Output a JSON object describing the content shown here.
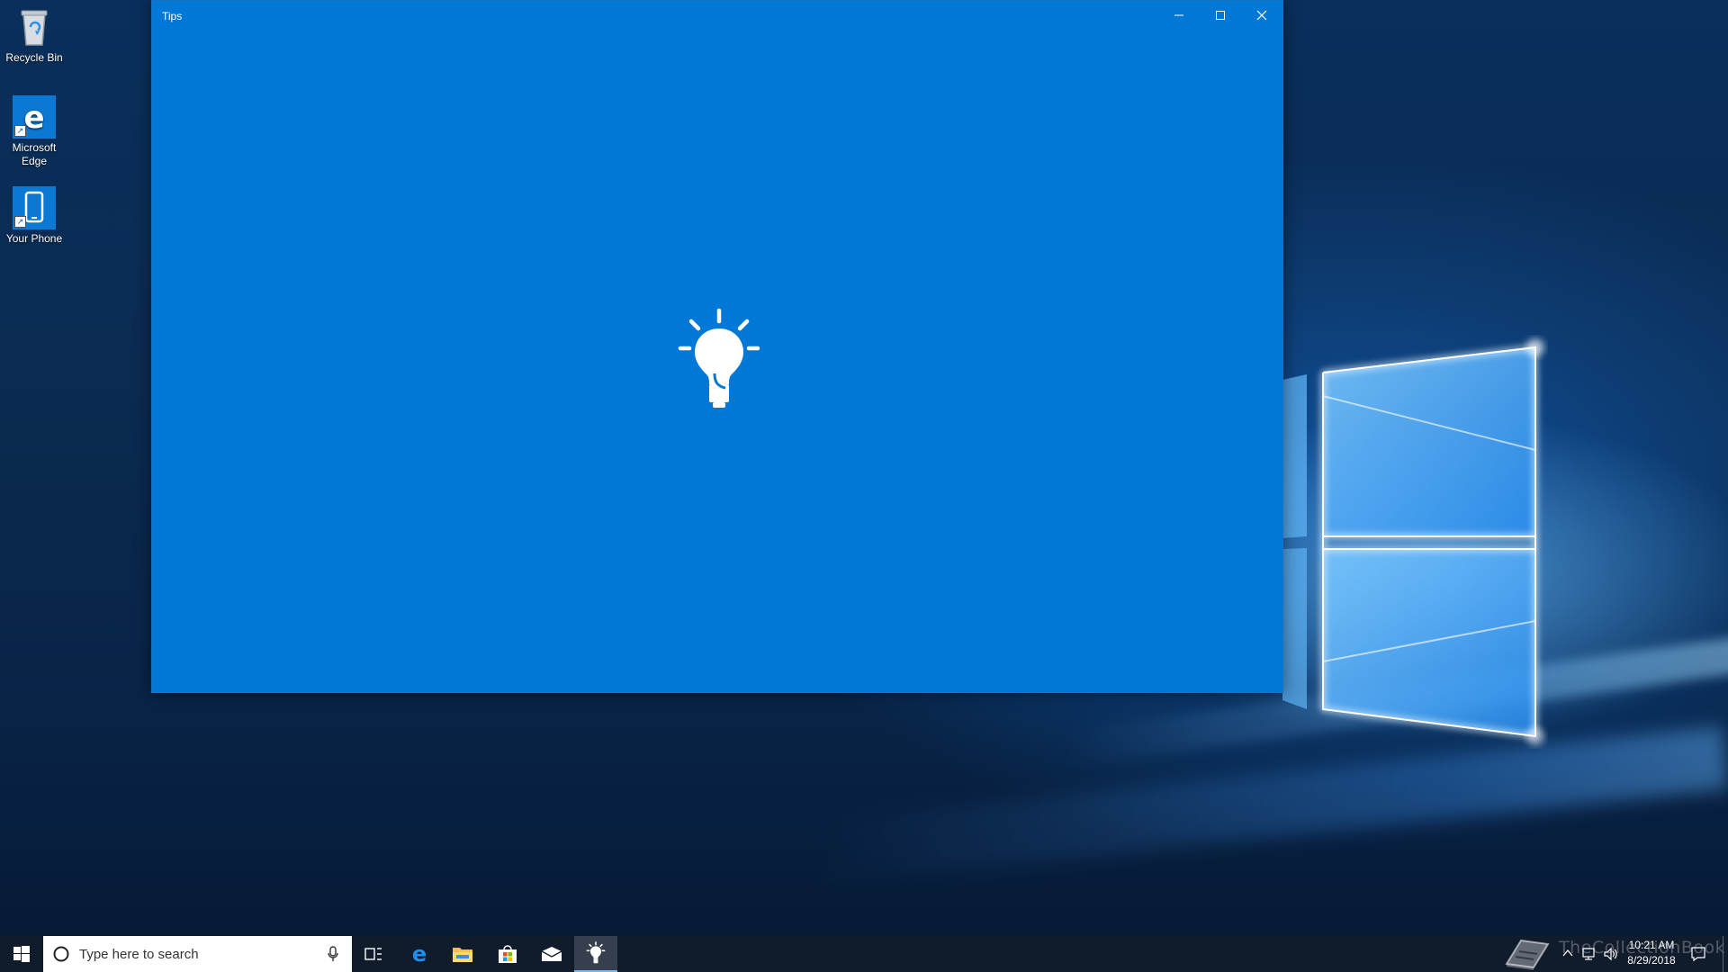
{
  "desktop": {
    "icons": [
      {
        "label": "Recycle Bin",
        "icon": "recycle-bin-icon"
      },
      {
        "label": "Microsoft Edge",
        "icon": "edge-icon"
      },
      {
        "label": "Your Phone",
        "icon": "phone-icon"
      }
    ]
  },
  "window": {
    "title": "Tips",
    "background": "#0078d7",
    "splash_icon": "lightbulb-icon",
    "controls": {
      "minimize": "minimize-icon",
      "maximize": "maximize-icon",
      "close": "close-icon"
    }
  },
  "taskbar": {
    "background": "#101b2b",
    "search_placeholder": "Type here to search",
    "pinned": [
      {
        "name": "task-view",
        "icon": "task-view-icon"
      },
      {
        "name": "microsoft-edge",
        "icon": "edge-icon"
      },
      {
        "name": "file-explorer",
        "icon": "folder-icon"
      },
      {
        "name": "microsoft-store",
        "icon": "store-icon"
      },
      {
        "name": "mail",
        "icon": "mail-icon"
      },
      {
        "name": "tips",
        "icon": "lightbulb-icon",
        "active": true
      }
    ],
    "clock": {
      "time": "10:21 AM",
      "date": "8/29/2018"
    },
    "watermark": "TheCollectionBook"
  }
}
